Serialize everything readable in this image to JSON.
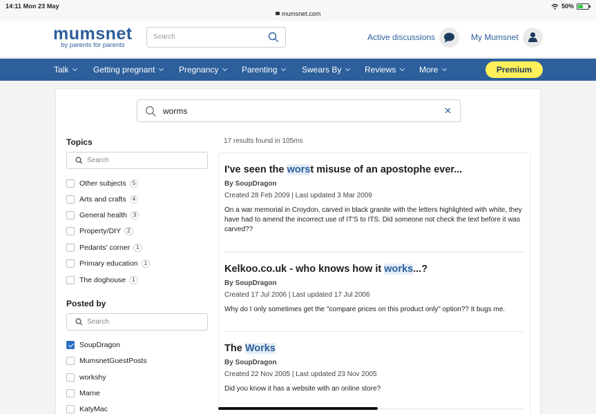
{
  "status_bar": {
    "time": "14:11  Mon 23 May",
    "url": "mumsnet.com",
    "battery": "50%"
  },
  "header": {
    "logo": "mumsnet",
    "tagline": "by parents for parents",
    "search_placeholder": "Search",
    "active_discussions": "Active discussions",
    "my_mumsnet": "My Mumsnet"
  },
  "nav": {
    "items": [
      "Talk",
      "Getting pregnant",
      "Pregnancy",
      "Parenting",
      "Swears By",
      "Reviews",
      "More"
    ],
    "premium": "Premium"
  },
  "search": {
    "query": "worms",
    "clear": "✕"
  },
  "topics": {
    "title": "Topics",
    "search_placeholder": "Search",
    "items": [
      {
        "label": "Other subjects",
        "count": "5"
      },
      {
        "label": "Arts and crafts",
        "count": "4"
      },
      {
        "label": "General health",
        "count": "3"
      },
      {
        "label": "Property/DIY",
        "count": "2"
      },
      {
        "label": "Pedants' corner",
        "count": "1"
      },
      {
        "label": "Primary education",
        "count": "1"
      },
      {
        "label": "The doghouse",
        "count": "1"
      }
    ]
  },
  "posted_by": {
    "title": "Posted by",
    "search_placeholder": "Search",
    "items": [
      {
        "label": "SoupDragon",
        "checked": true
      },
      {
        "label": "MumsnetGuestPosts",
        "checked": false
      },
      {
        "label": "workshy",
        "checked": false
      },
      {
        "label": "Marne",
        "checked": false
      },
      {
        "label": "KatyMac",
        "checked": false
      }
    ]
  },
  "results": {
    "meta": "17 results found in 105ms",
    "items": [
      {
        "title_pre": "I've seen the ",
        "title_hl": "wors",
        "title_post": "t misuse of an apostophe ever...",
        "author": "By SoupDragon",
        "dates": "Created 28 Feb 2009 | Last updated 3 Mar 2009",
        "snippet": "On a war memorial in Croydon, carved in black granite with the letters highlighted with white, they have had to amend the incorrect use of IT'S to ITS. Did someone not check the text before it was carved??"
      },
      {
        "title_pre": "Kelkoo.co.uk - who knows how it ",
        "title_hl": "works",
        "title_post": "...?",
        "author": "By SoupDragon",
        "dates": "Created 17 Jul 2006 | Last updated 17 Jul 2006",
        "snippet": "Why do I only sometimes get the \"compare prices on this product only\" option?? It bugs me."
      },
      {
        "title_pre": "The ",
        "title_hl": "Works",
        "title_post": "",
        "author": "By SoupDragon",
        "dates": "Created 22 Nov 2005 | Last updated 23 Nov 2005",
        "snippet": "Did you know it has a website with an online store?"
      }
    ]
  }
}
